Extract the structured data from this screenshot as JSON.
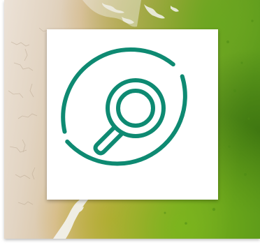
{
  "image": {
    "background": "aerial-salt-flat-to-green-algae-texture",
    "card": {
      "icon": "search-circle-icon"
    }
  },
  "colors": {
    "icon_stroke": "#0e8a72",
    "card_background": "#ffffff",
    "sand_light": "#e9ddd0",
    "sand_mid": "#d6c3a8",
    "ochre": "#c9a24a",
    "olive": "#9aa63a",
    "green": "#5f9a1f",
    "deep_green": "#3f7d12",
    "salt_white": "#f4f4f1"
  }
}
